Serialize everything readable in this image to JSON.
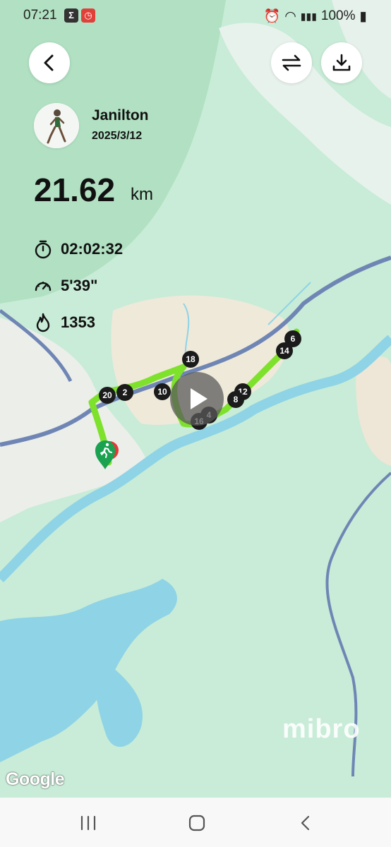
{
  "status": {
    "time": "07:21",
    "battery": "100%"
  },
  "user": {
    "name": "Janilton",
    "date": "2025/3/12"
  },
  "distance": {
    "value": "21.62",
    "unit": "km"
  },
  "stats": {
    "duration": "02:02:32",
    "pace": "5'39\"",
    "calories": "1353"
  },
  "map": {
    "watermark": "Google",
    "brand": "mibro",
    "km_markers": [
      "2",
      "4",
      "6",
      "8",
      "10",
      "12",
      "14",
      "16",
      "18",
      "20"
    ]
  },
  "icons": {
    "back": "chevron-left-icon",
    "swap": "swap-arrows-icon",
    "download": "download-icon",
    "timer": "stopwatch-icon",
    "pace": "speedometer-icon",
    "calories": "flame-icon",
    "play": "play-icon",
    "runner": "runner-icon"
  },
  "colors": {
    "route": "#7ee12c",
    "start_marker": "#1aa251",
    "water": "#8fd3e6",
    "road": "#6f86b5"
  }
}
